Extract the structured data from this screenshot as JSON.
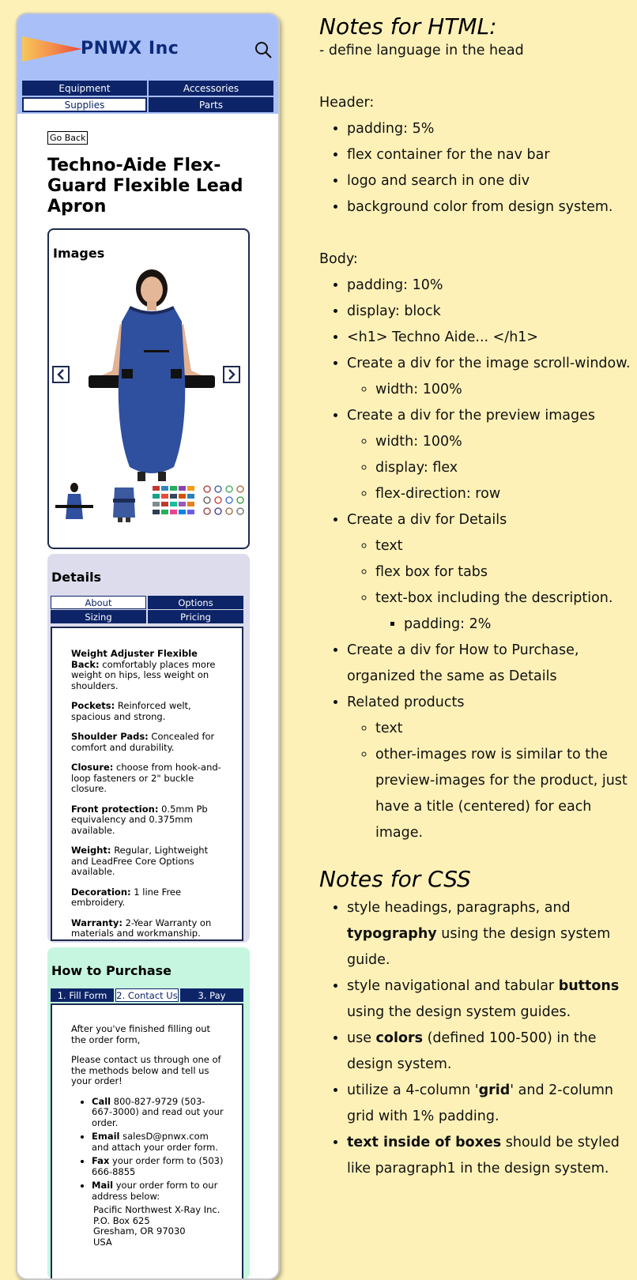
{
  "mockup": {
    "logo": {
      "text": "PNWX Inc",
      "icon": "pennant-logo"
    },
    "search_icon": "search-icon",
    "nav": [
      {
        "label": "Equipment",
        "active": false
      },
      {
        "label": "Accessories",
        "active": false
      },
      {
        "label": "Supplies",
        "active": true
      },
      {
        "label": "Parts",
        "active": false
      }
    ],
    "go_back": "Go Back",
    "product_title": "Techno-Aide Flex-Guard Flexible Lead Apron",
    "images": {
      "heading": "Images",
      "prev_icon": "chevron-left-icon",
      "next_icon": "chevron-right-icon"
    },
    "details": {
      "heading": "Details",
      "tabs": [
        {
          "label": "About",
          "active": true
        },
        {
          "label": "Options",
          "active": false
        },
        {
          "label": "Sizing",
          "active": false
        },
        {
          "label": "Pricing",
          "active": false
        }
      ],
      "items": [
        {
          "term": "Weight Adjuster Flexible Back:",
          "text": " comfortably places more weight on hips, less weight on shoulders."
        },
        {
          "term": "Pockets:",
          "text": " Reinforced welt, spacious and strong."
        },
        {
          "term": "Shoulder Pads:",
          "text": " Concealed for comfort and durability."
        },
        {
          "term": "Closure:",
          "text": " choose from hook-and-loop fasteners or 2\" buckle closure."
        },
        {
          "term": "Front protection:",
          "text": " 0.5mm Pb equivalency and 0.375mm available."
        },
        {
          "term": "Weight:",
          "text": " Regular, Lightweight and LeadFree Core Options available."
        },
        {
          "term": "Decoration:",
          "text": " 1 line Free embroidery."
        },
        {
          "term": "Warranty:",
          "text": " 2-Year Warranty on materials and workmanship."
        }
      ]
    },
    "purchase": {
      "heading": "How to Purchase",
      "tabs": [
        {
          "label": "1. Fill Form",
          "active": false
        },
        {
          "label": "2. Contact Us",
          "active": true
        },
        {
          "label": "3. Pay",
          "active": false
        }
      ],
      "intro1": "After you've finished filling out the order form,",
      "intro2": "Please contact us through one of the methods below and tell us your order!",
      "methods": [
        {
          "term": "Call",
          "text": " 800-827-9729 (503-667-3000) and read out your order."
        },
        {
          "term": "Email",
          "text": " salesD@pnwx.com and attach your order form."
        },
        {
          "term": "Fax",
          "text": " your order form to (503) 666-8855"
        },
        {
          "term": "Mail",
          "text": " your order form to our address below:"
        }
      ],
      "address": [
        "Pacific Northwest X-Ray Inc.",
        "P.O. Box 625",
        "Gresham, OR 97030",
        "USA"
      ]
    }
  },
  "notes": {
    "html_heading": "Notes for HTML:",
    "html_intro": "- define language in the head",
    "header_label": "Header:",
    "header_items": [
      "padding: 5%",
      "flex container for the nav bar",
      "logo and search in one div",
      "background color from design system."
    ],
    "body_label": "Body:",
    "body_items": {
      "padding": "padding: 10%",
      "display": "display: block",
      "h1": "<h1> Techno Aide... </h1>",
      "scroll": "Create a div for the image scroll-window.",
      "scroll_sub": [
        "width: 100%"
      ],
      "preview": "Create a div for the preview images",
      "preview_sub": [
        "width: 100%",
        "display: flex",
        "flex-direction: row"
      ],
      "details": "Create a div for Details",
      "details_sub": [
        "text",
        "flex box for tabs",
        "text-box including the description."
      ],
      "details_sub_sub": [
        "padding: 2%"
      ],
      "purchase": "Create a div for How to Purchase, organized the same as Details",
      "related": "Related products",
      "related_sub": [
        "text",
        "other-images row is similar to the preview-images for the product, just have a title (centered) for each image."
      ]
    },
    "css_heading": "Notes for CSS",
    "css_items": [
      {
        "pre": "style headings, paragraphs, and ",
        "bold": "typography",
        "post": " using the design system guide."
      },
      {
        "pre": "style navigational and tabular ",
        "bold": "buttons",
        "post": " using the design system guides."
      },
      {
        "pre": "use ",
        "bold": "colors",
        "post": " (defined 100-500) in the design system."
      },
      {
        "pre": "utilize a 4-column '",
        "bold": "grid",
        "post": "' and 2-column grid with 1% padding."
      },
      {
        "pre": "",
        "bold": "text inside of boxes",
        "post": " should be styled like paragraph1 in the design system."
      }
    ]
  }
}
